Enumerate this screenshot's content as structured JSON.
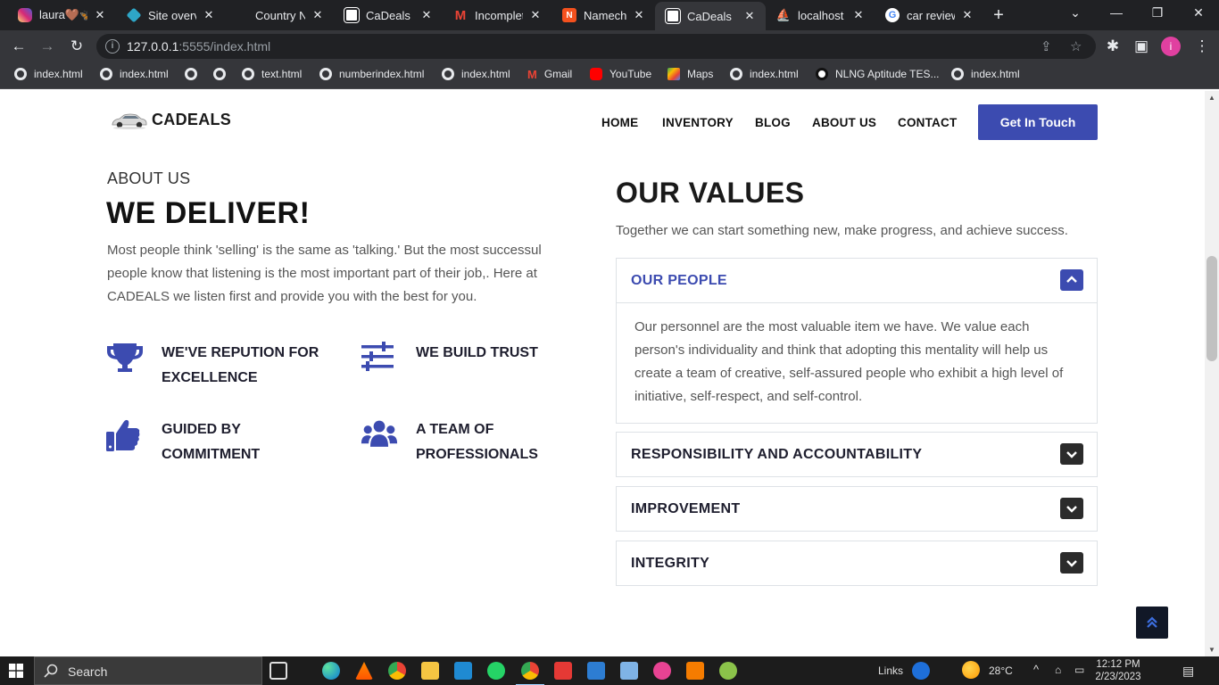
{
  "browser": {
    "tabs": [
      {
        "title": "laura🤎🦋",
        "favicon": "instagram-icon",
        "color": "#d62976",
        "active": false
      },
      {
        "title": "Site overvie",
        "favicon": "diamond-icon",
        "color": "#2ea6c7",
        "active": false
      },
      {
        "title": "Country N",
        "favicon": "none",
        "color": "#202124",
        "active": false
      },
      {
        "title": "CaDeals",
        "favicon": "page-icon",
        "color": "#ffffff",
        "active": false
      },
      {
        "title": "Incomplete",
        "favicon": "gmail-icon",
        "color": "#ea4335",
        "active": false
      },
      {
        "title": "Namechea",
        "favicon": "namecheap-icon",
        "color": "#f4511e",
        "active": false
      },
      {
        "title": "CaDeals",
        "favicon": "page-icon",
        "color": "#ffffff",
        "active": true
      },
      {
        "title": "localhost /",
        "favicon": "phpmyadmin-icon",
        "color": "#f29111",
        "active": false
      },
      {
        "title": "car reviews",
        "favicon": "google-icon",
        "color": "#4285f4",
        "active": false
      }
    ],
    "url_host": "127.0.0.1",
    "url_rest": ":5555/index.html",
    "profile_initial": "i",
    "bookmarks": [
      {
        "label": "index.html",
        "icon": "instagram-icon"
      },
      {
        "label": "index.html",
        "icon": "globe-icon"
      },
      {
        "label": "",
        "icon": "globe-icon"
      },
      {
        "label": "",
        "icon": "globe-icon"
      },
      {
        "label": "text.html",
        "icon": "globe-icon"
      },
      {
        "label": "numberindex.html",
        "icon": "globe-icon"
      },
      {
        "label": "index.html",
        "icon": "globe-icon"
      },
      {
        "label": "Gmail",
        "icon": "gmail-icon"
      },
      {
        "label": "YouTube",
        "icon": "youtube-icon"
      },
      {
        "label": "Maps",
        "icon": "maps-icon"
      },
      {
        "label": "index.html",
        "icon": "globe-icon"
      },
      {
        "label": "NLNG Aptitude TES...",
        "icon": "nlng-icon"
      },
      {
        "label": "index.html",
        "icon": "globe-icon"
      }
    ]
  },
  "site": {
    "brand": "CADEALS",
    "nav": {
      "home": "HOME",
      "inventory": "INVENTORY",
      "blog": "BLOG",
      "about": "ABOUT US",
      "contact": "CONTACT"
    },
    "cta": "Get In Touch",
    "about": {
      "kicker": "ABOUT US",
      "title": "WE DELIVER!",
      "text": "Most people think 'selling' is the same as 'talking.' But the most successul people know that listening is the most important part of their job,. Here at CADEALS we listen first and provide you with the best for you.",
      "features": [
        {
          "label": "WE'VE REPUTION FOR EXCELLENCE",
          "icon": "trophy-icon"
        },
        {
          "label": "WE BUILD TRUST",
          "icon": "sliders-icon"
        },
        {
          "label": "GUIDED BY COMMITMENT",
          "icon": "thumbs-up-icon"
        },
        {
          "label": "A TEAM OF PROFESSIONALS",
          "icon": "users-icon"
        }
      ]
    },
    "values": {
      "title": "OUR VALUES",
      "subtitle": "Together we can start something new, make progress, and achieve success.",
      "items": [
        {
          "title": "OUR PEOPLE",
          "expanded": true,
          "body": "Our personnel are the most valuable item we have. We value each person's individuality and think that adopting this mentality will help us create a team of creative, self-assured people who exhibit a high level of initiative, self-respect, and self-control."
        },
        {
          "title": "RESPONSIBILITY AND ACCOUNTABILITY",
          "expanded": false
        },
        {
          "title": "IMPROVEMENT",
          "expanded": false
        },
        {
          "title": "INTEGRITY",
          "expanded": false
        }
      ]
    },
    "accent_color": "#3c4bb0"
  },
  "taskbar": {
    "search_placeholder": "Search",
    "links_label": "Links",
    "weather": "28°C",
    "time": "12:12 PM",
    "date": "2/23/2023"
  }
}
